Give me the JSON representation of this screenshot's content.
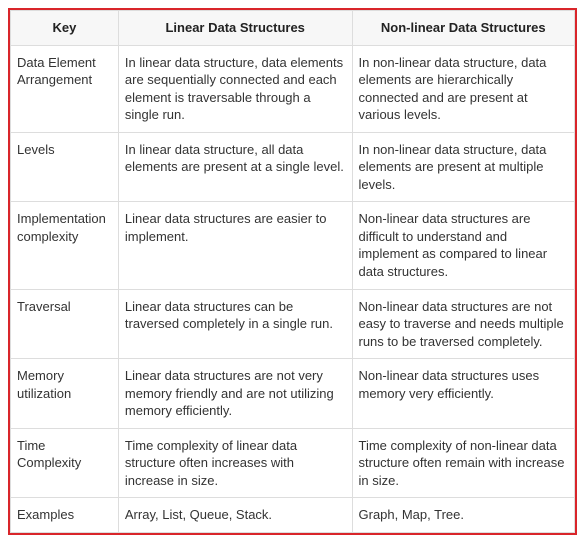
{
  "table": {
    "headers": [
      "Key",
      "Linear Data Structures",
      "Non-linear Data Structures"
    ],
    "rows": [
      {
        "key": "Data Element Arrangement",
        "linear": "In linear data structure, data elements are sequentially connected and each element is traversable through a single run.",
        "nonlinear": "In non-linear data structure, data elements are hierarchically connected and are present at various levels."
      },
      {
        "key": "Levels",
        "linear": "In linear data structure, all data elements are present at a single level.",
        "nonlinear": "In non-linear data structure, data elements are present at multiple levels."
      },
      {
        "key": "Implementation complexity",
        "linear": "Linear data structures are easier to implement.",
        "nonlinear": "Non-linear data structures are difficult to understand and implement as compared to linear data structures."
      },
      {
        "key": "Traversal",
        "linear": "Linear data structures can be traversed completely in a single run.",
        "nonlinear": "Non-linear data structures are not easy to traverse and needs multiple runs to be traversed completely."
      },
      {
        "key": "Memory utilization",
        "linear": "Linear data structures are not very memory friendly and are not utilizing memory efficiently.",
        "nonlinear": "Non-linear data structures uses memory very efficiently."
      },
      {
        "key": "Time Complexity",
        "linear": "Time complexity of linear data structure often increases with increase in size.",
        "nonlinear": "Time complexity of non-linear data structure often remain with increase in size."
      },
      {
        "key": "Examples",
        "linear": "Array, List, Queue, Stack.",
        "nonlinear": "Graph, Map, Tree."
      }
    ]
  }
}
